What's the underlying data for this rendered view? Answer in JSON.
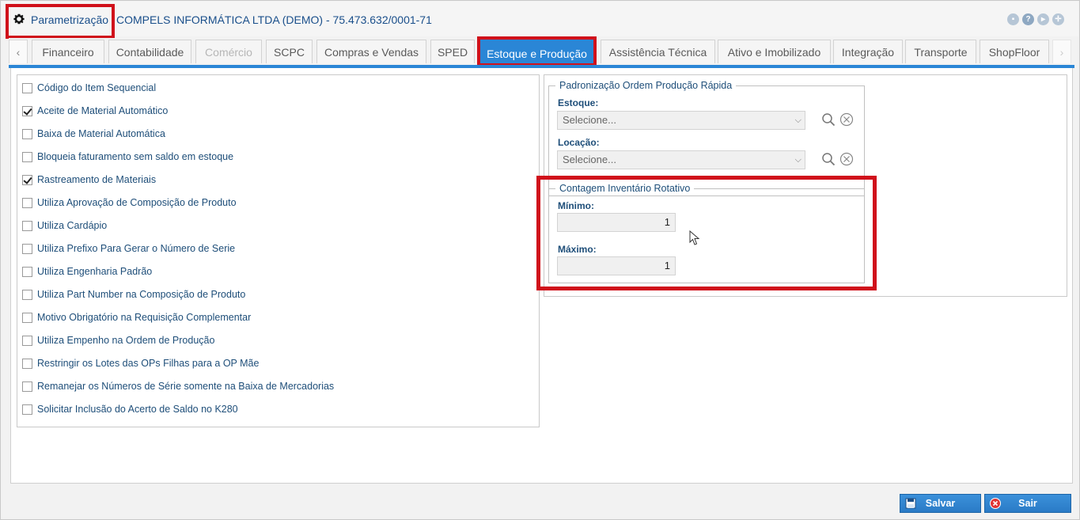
{
  "window": {
    "title": "Parametrização",
    "company": "COMPELS INFORMÁTICA LTDA (DEMO) - 75.473.632/0001-71",
    "icons": [
      "minimize-icon",
      "help-icon",
      "play-icon",
      "compass-icon"
    ]
  },
  "tabs": [
    {
      "label": "Financeiro",
      "state": "normal"
    },
    {
      "label": "Contabilidade",
      "state": "normal"
    },
    {
      "label": "Comércio",
      "state": "disabled"
    },
    {
      "label": "SCPC",
      "state": "normal"
    },
    {
      "label": "Compras e Vendas",
      "state": "normal"
    },
    {
      "label": "SPED",
      "state": "normal"
    },
    {
      "label": "Estoque e Produção",
      "state": "active"
    },
    {
      "label": "Assistência Técnica",
      "state": "normal"
    },
    {
      "label": "Ativo e Imobilizado",
      "state": "normal"
    },
    {
      "label": "Integração",
      "state": "normal"
    },
    {
      "label": "Transporte",
      "state": "normal"
    },
    {
      "label": "ShopFloor",
      "state": "normal"
    }
  ],
  "options": [
    {
      "label": "Código do Item Sequencial",
      "checked": false
    },
    {
      "label": "Aceite de Material Automático",
      "checked": true
    },
    {
      "label": "Baixa de Material Automática",
      "checked": false
    },
    {
      "label": "Bloqueia faturamento sem saldo em estoque",
      "checked": false
    },
    {
      "label": "Rastreamento de Materiais",
      "checked": true
    },
    {
      "label": "Utiliza Aprovação de Composição de Produto",
      "checked": false
    },
    {
      "label": "Utiliza Cardápio",
      "checked": false
    },
    {
      "label": "Utiliza Prefixo Para Gerar o Número de Serie",
      "checked": false
    },
    {
      "label": "Utiliza Engenharia Padrão",
      "checked": false
    },
    {
      "label": "Utiliza Part Number na Composição de Produto",
      "checked": false
    },
    {
      "label": "Motivo Obrigatório na Requisição Complementar",
      "checked": false
    },
    {
      "label": "Utiliza Empenho na Ordem de Produção",
      "checked": false
    },
    {
      "label": "Restringir os Lotes das OPs Filhas para a OP Mãe",
      "checked": false
    },
    {
      "label": "Remanejar os Números de Série somente na Baixa de Mercadorias",
      "checked": false
    },
    {
      "label": "Solicitar Inclusão do Acerto de Saldo no K280",
      "checked": false
    }
  ],
  "producao_rapida": {
    "legend": "Padronização Ordem Produção Rápida",
    "estoque_label": "Estoque:",
    "estoque_value": "Selecione...",
    "locacao_label": "Locação:",
    "locacao_value": "Selecione..."
  },
  "inventario": {
    "legend": "Contagem Inventário Rotativo",
    "minimo_label": "Mínimo:",
    "minimo_value": "1",
    "maximo_label": "Máximo:",
    "maximo_value": "1"
  },
  "footer": {
    "save_label": "Salvar",
    "exit_label": "Sair"
  },
  "colors": {
    "accent": "#2a86d6",
    "highlight": "#d0111b",
    "text": "#1e4e79"
  }
}
